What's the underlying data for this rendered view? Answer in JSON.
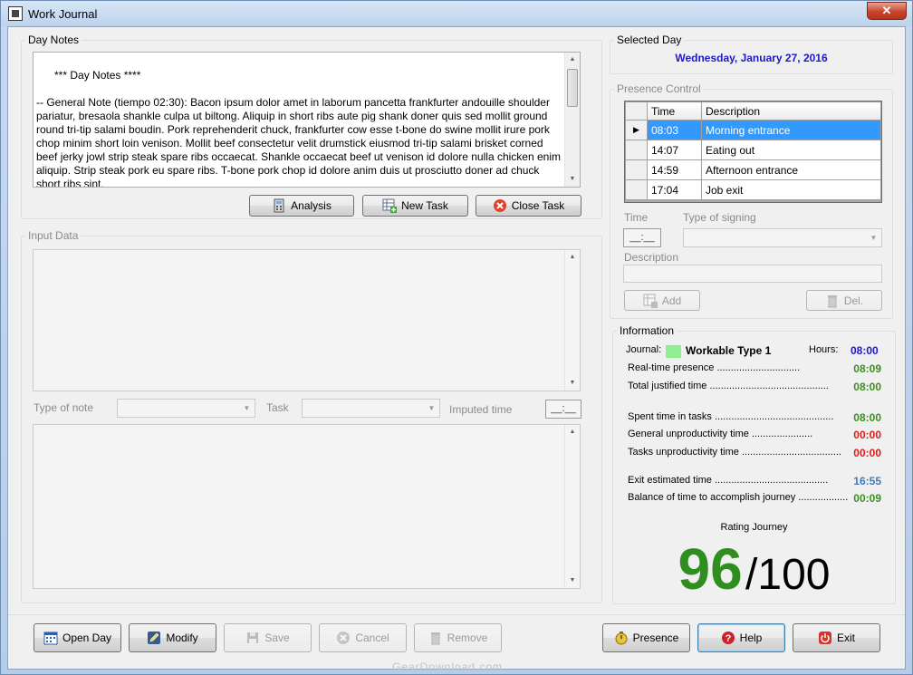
{
  "window": {
    "title": "Work Journal",
    "close_glyph": "✕"
  },
  "day_notes": {
    "label": "Day Notes",
    "text": "*** Day Notes ****\n\n-- General Note (tiempo 02:30): Bacon ipsum dolor amet in laborum pancetta frankfurter andouille shoulder pariatur, bresaola shankle culpa ut biltong. Aliquip in short ribs aute pig shank doner quis sed mollit ground round tri-tip salami boudin. Pork reprehenderit chuck, frankfurter cow esse t-bone do swine mollit irure pork chop minim short loin venison. Mollit beef consectetur velit drumstick eiusmod tri-tip salami brisket corned beef jerky jowl strip steak spare ribs occaecat. Shankle occaecat beef ut venison id dolore nulla chicken enim aliquip. Strip steak pork eu spare ribs. T-bone pork chop id dolore anim duis ut prosciutto doner ad chuck short ribs sint.",
    "buttons": {
      "analysis": "Analysis",
      "new_task": "New Task",
      "close_task": "Close Task"
    }
  },
  "input_data": {
    "label": "Input Data",
    "type_of_note_label": "Type of note",
    "task_label": "Task",
    "imputed_time_label": "Imputed time",
    "imputed_time_value": "__:__"
  },
  "selected_day": {
    "label": "Selected Day",
    "date": "Wednesday, January 27, 2016"
  },
  "presence_control": {
    "label": "Presence Control",
    "columns": [
      "Time",
      "Description"
    ],
    "rows": [
      {
        "time": "08:03",
        "description": "Morning entrance"
      },
      {
        "time": "14:07",
        "description": "Eating out"
      },
      {
        "time": "14:59",
        "description": "Afternoon entrance"
      },
      {
        "time": "17:04",
        "description": "Job exit"
      }
    ],
    "time_label": "Time",
    "time_value": "__:__",
    "type_of_signing_label": "Type of signing",
    "description_label": "Description",
    "add_label": "Add",
    "del_label": "Del."
  },
  "information": {
    "label": "Information",
    "journal_label": "Journal:",
    "journal_type": "Workable Type 1",
    "hours_label": "Hours:",
    "hours_value": "08:00",
    "rows": [
      {
        "label": "Real-time presence",
        "value": "08:09"
      },
      {
        "label": "Total justified time",
        "value": "08:00"
      },
      {
        "label": "Spent time in tasks",
        "value": "08:00"
      },
      {
        "label": "General unproductivity time",
        "value": "00:00"
      },
      {
        "label": "Tasks unproductivity time",
        "value": "00:00"
      },
      {
        "label": "Exit estimated time",
        "value": "16:55"
      },
      {
        "label": "Balance of time to accomplish journey",
        "value": "00:09"
      }
    ],
    "rating_label": "Rating Journey",
    "rating_value": "96",
    "rating_max": "/100"
  },
  "bottom_buttons": {
    "open_day": "Open Day",
    "modify": "Modify",
    "save": "Save",
    "cancel": "Cancel",
    "remove": "Remove",
    "presence": "Presence",
    "help": "Help",
    "exit": "Exit"
  },
  "colors": {
    "selection": "#3399ff",
    "date_blue": "#1d19c8",
    "value_green": "#3e8f1f",
    "value_red": "#e31b1b",
    "value_lightblue": "#4279b8",
    "journal_swatch": "#90ee90"
  },
  "watermark": "GearDownload.com"
}
